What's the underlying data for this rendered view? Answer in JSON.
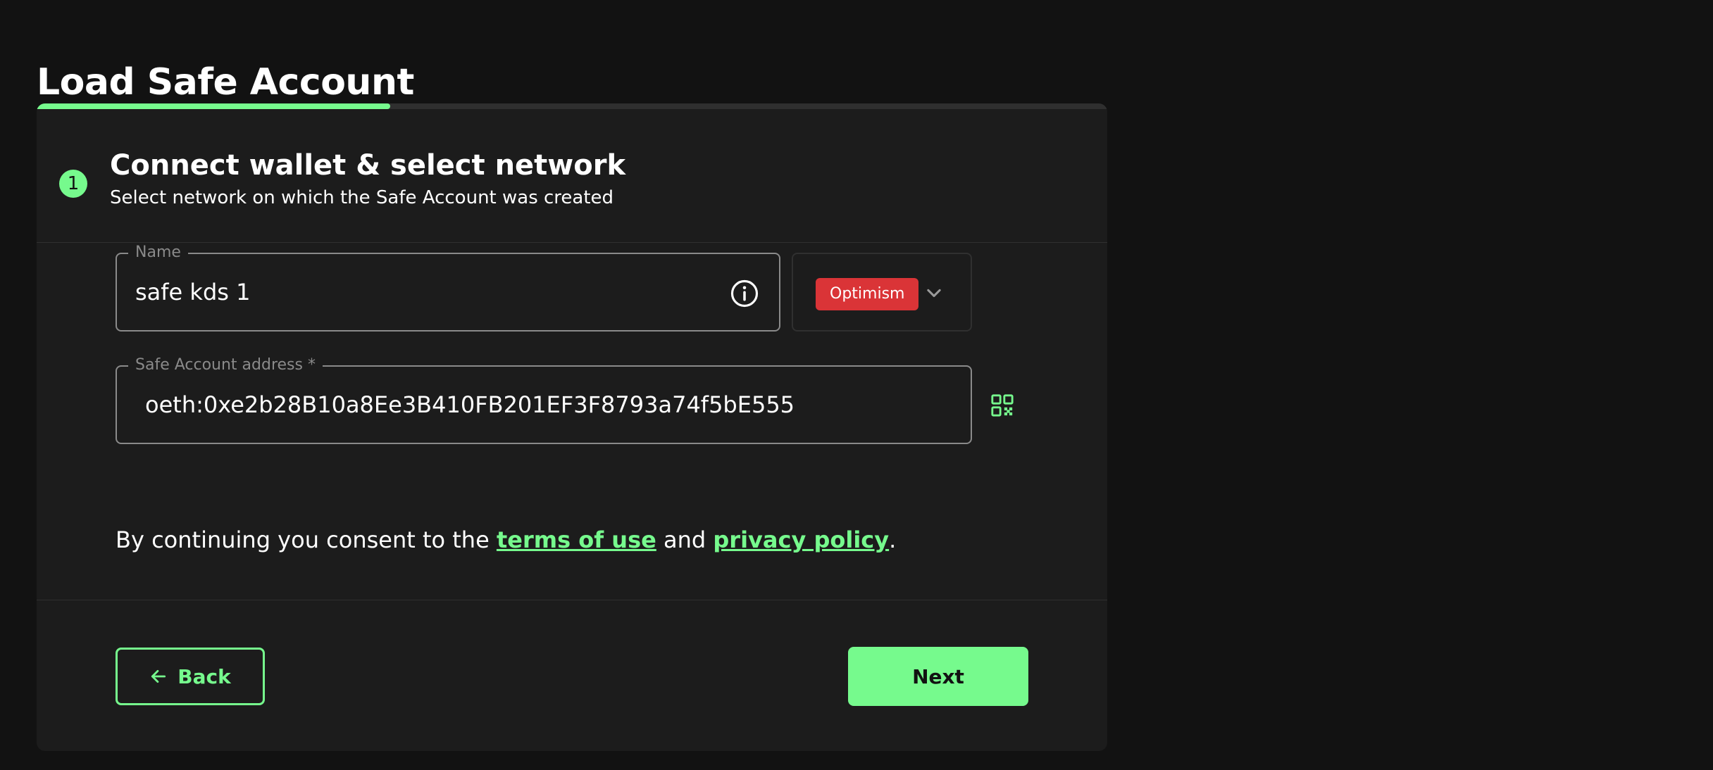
{
  "page": {
    "title": "Load Safe Account"
  },
  "progress": {
    "fraction": 0.33
  },
  "step": {
    "number": "1",
    "title": "Connect wallet & select network",
    "subtitle": "Select network on which the Safe Account was created"
  },
  "form": {
    "name": {
      "label": "Name",
      "value": "safe kds 1",
      "info_icon": "info-circle-icon"
    },
    "network": {
      "selected": "Optimism",
      "chip_color": "#da3437",
      "chevron_icon": "chevron-down-icon"
    },
    "address": {
      "label": "Safe Account address *",
      "value": "oeth:0xe2b28B10a8Ee3B410FB201EF3F8793a74f5bE555",
      "qr_icon": "qr-code-icon"
    },
    "consent": {
      "prefix": "By continuing you consent to the ",
      "terms_link": "terms of use",
      "middle": " and ",
      "privacy_link": "privacy policy",
      "suffix": "."
    }
  },
  "actions": {
    "back_label": "Back",
    "back_icon": "arrow-left-icon",
    "next_label": "Next"
  },
  "colors": {
    "accent": "#76fa8d",
    "background": "#121212",
    "card": "#1c1c1c",
    "network_optimism": "#da3437"
  }
}
